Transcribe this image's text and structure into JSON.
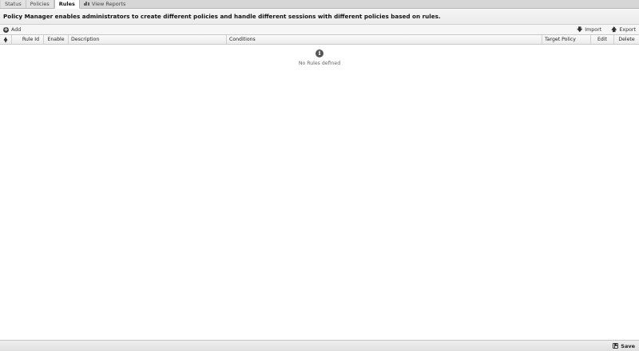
{
  "tabs": [
    {
      "label": "Status",
      "active": false
    },
    {
      "label": "Policies",
      "active": false
    },
    {
      "label": "Rules",
      "active": true
    },
    {
      "label": "View Reports",
      "active": false,
      "icon": "bar-chart-icon"
    }
  ],
  "description": "Policy Manager enables administrators to create different policies and handle different sessions with different policies based on rules.",
  "toolbar": {
    "add_label": "Add",
    "import_label": "Import",
    "export_label": "Export"
  },
  "grid": {
    "columns": [
      "Rule Id",
      "Enable",
      "Description",
      "Conditions",
      "Target Policy",
      "Edit",
      "Delete"
    ],
    "empty_message": "No Rules defined"
  },
  "footer": {
    "save_label": "Save"
  },
  "colors": {
    "tabbar_bg": "#d6d6d6",
    "active_tab_bg": "#ffffff",
    "header_bg": "#ececec"
  }
}
